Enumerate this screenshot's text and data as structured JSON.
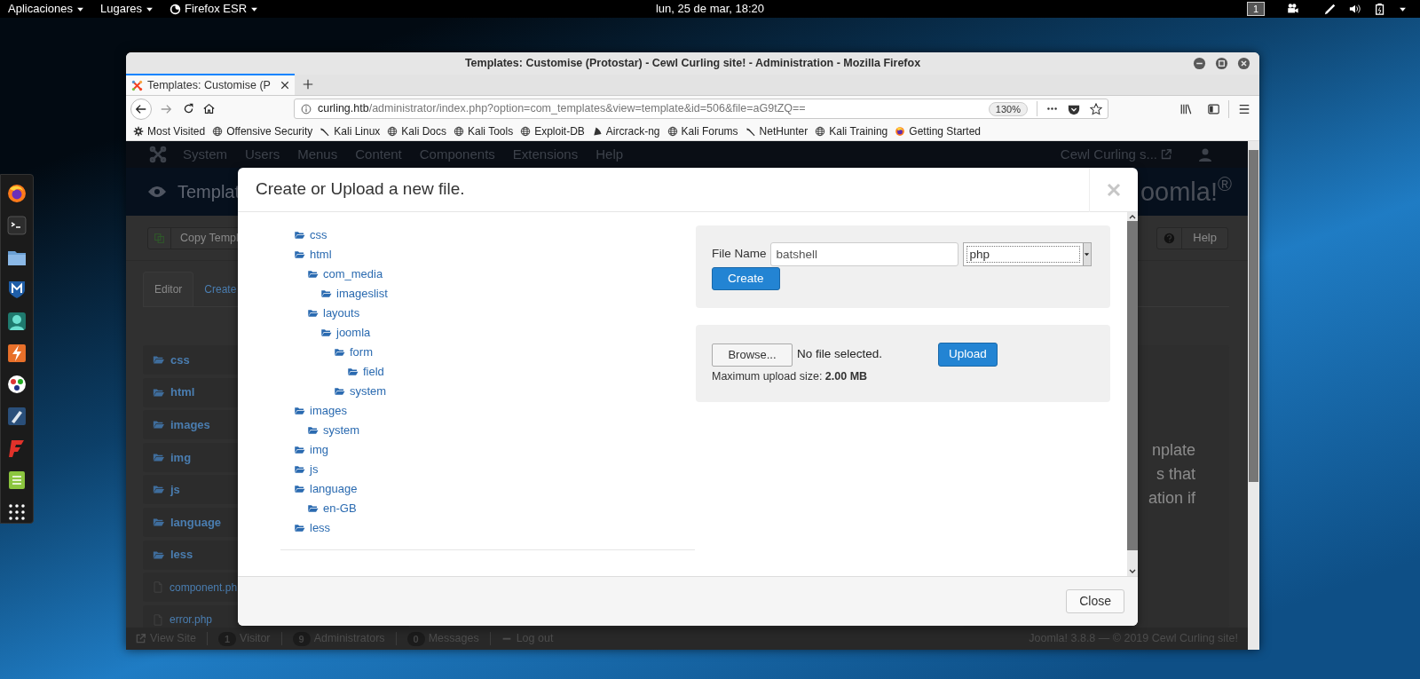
{
  "top_bar": {
    "menus": [
      "Aplicaciones",
      "Lugares",
      "Firefox ESR"
    ],
    "clock": "lun, 25 de mar, 18:20",
    "workspace": "1"
  },
  "browser": {
    "title": "Templates: Customise (Protostar) - Cewl Curling site! - Administration - Mozilla Firefox",
    "tabs": [
      {
        "title": "Templates: Customise (P",
        "selected": true
      }
    ],
    "url": {
      "host": "curling.htb",
      "path": "/administrator/index.php?option=com_templates&view=template&id=506&file=aG9tZQ=="
    },
    "zoom": "130%",
    "bookmarks": [
      "Most Visited",
      "Offensive Security",
      "Kali Linux",
      "Kali Docs",
      "Kali Tools",
      "Exploit-DB",
      "Aircrack-ng",
      "Kali Forums",
      "NetHunter",
      "Kali Training",
      "Getting Started"
    ]
  },
  "page": {
    "nav": [
      "System",
      "Users",
      "Menus",
      "Content",
      "Components",
      "Extensions",
      "Help"
    ],
    "site_link": "Cewl Curling s...",
    "header_title": "Templat",
    "logo": "oomla!$^{®}$",
    "toolbar": {
      "copy": "Copy Templ",
      "help": "Help"
    },
    "tabs": [
      {
        "label": "Editor",
        "selected": true
      },
      {
        "label": "Create",
        "selected": false
      }
    ],
    "files": [
      {
        "name": "css",
        "kind": "folder"
      },
      {
        "name": "html",
        "kind": "folder"
      },
      {
        "name": "images",
        "kind": "folder"
      },
      {
        "name": "img",
        "kind": "folder"
      },
      {
        "name": "js",
        "kind": "folder"
      },
      {
        "name": "language",
        "kind": "folder"
      },
      {
        "name": "less",
        "kind": "folder"
      },
      {
        "name": "component.ph",
        "kind": "file"
      },
      {
        "name": "error.php",
        "kind": "file"
      }
    ],
    "description_lines": [
      "nplate",
      "s that",
      "ation if"
    ],
    "status_bar": {
      "view_site": "View Site",
      "counters": [
        {
          "count": "1",
          "label": "Visitor"
        },
        {
          "count": "9",
          "label": "Administrators"
        },
        {
          "count": "0",
          "label": "Messages"
        }
      ],
      "logout": "Log out",
      "version": "Joomla! 3.8.8 — © 2019 Cewl Curling site!"
    }
  },
  "modal": {
    "title": "Create or Upload a new file.",
    "tree": [
      {
        "name": "css"
      },
      {
        "name": "html",
        "children": [
          {
            "name": "com_media",
            "children": [
              {
                "name": "imageslist"
              }
            ]
          },
          {
            "name": "layouts",
            "children": [
              {
                "name": "joomla",
                "children": [
                  {
                    "name": "form",
                    "children": [
                      {
                        "name": "field"
                      }
                    ]
                  },
                  {
                    "name": "system"
                  }
                ]
              }
            ]
          }
        ]
      },
      {
        "name": "images",
        "children": [
          {
            "name": "system"
          }
        ]
      },
      {
        "name": "img"
      },
      {
        "name": "js"
      },
      {
        "name": "language",
        "children": [
          {
            "name": "en-GB"
          }
        ]
      },
      {
        "name": "less"
      }
    ],
    "create": {
      "label": "File Name",
      "value": "batshell",
      "type": "php",
      "button": "Create"
    },
    "upload": {
      "browse": "Browse...",
      "file_status": "No file selected.",
      "button": "Upload",
      "limit": "Maximum upload size: **2.00 MB**"
    },
    "close": "Close"
  }
}
